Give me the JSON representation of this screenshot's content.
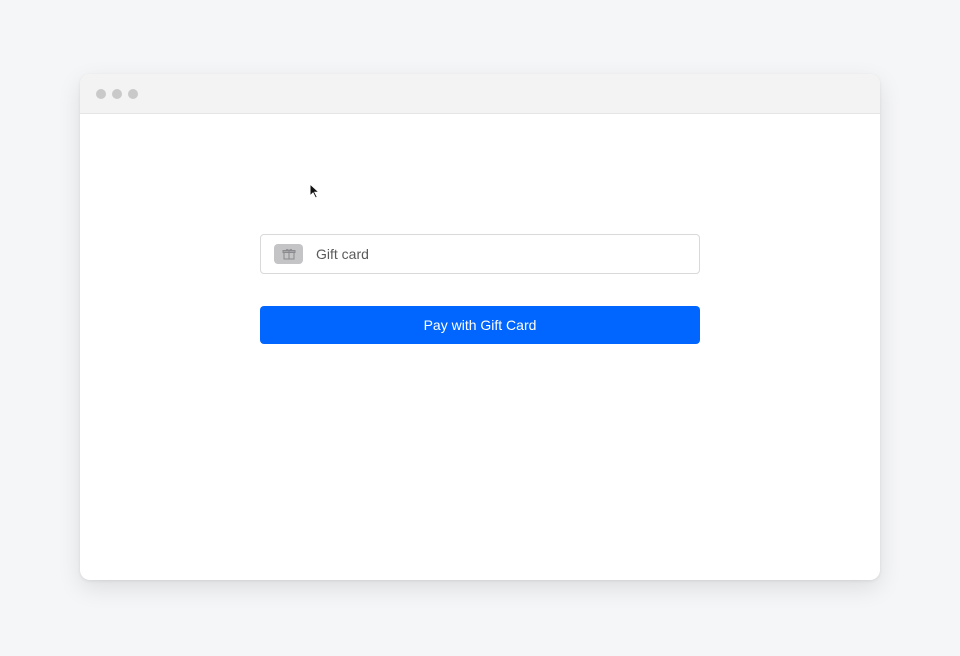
{
  "window": {
    "controls": [
      "close",
      "minimize",
      "maximize"
    ]
  },
  "form": {
    "gift_card_placeholder": "Gift card",
    "gift_card_value": "",
    "gift_icon": "gift-icon",
    "pay_button_label": "Pay with Gift Card"
  },
  "colors": {
    "accent": "#0066ff",
    "window_controls": "#c9c9c9",
    "badge": "#c4c4c7"
  }
}
